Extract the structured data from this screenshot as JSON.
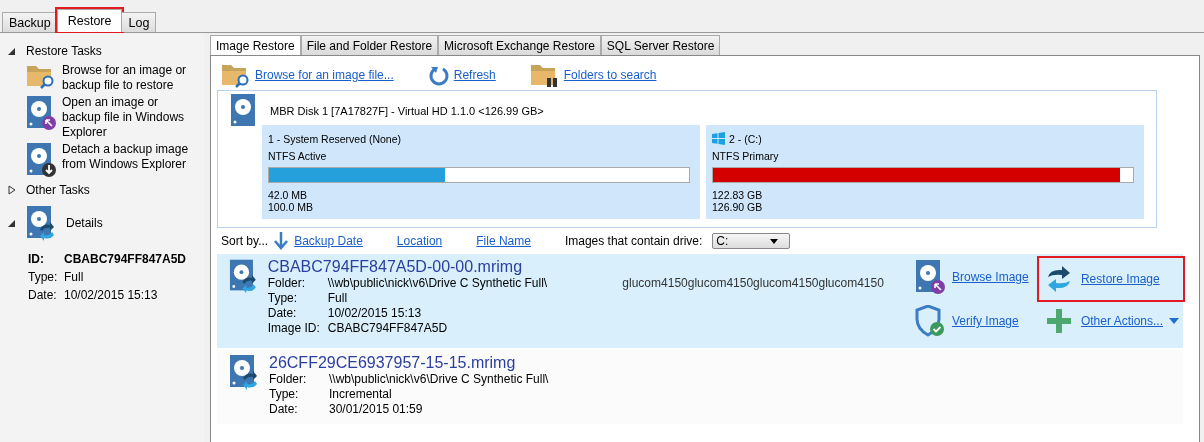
{
  "app_tabs": [
    {
      "label": "Backup",
      "selected": false,
      "highlighted": false
    },
    {
      "label": "Restore",
      "selected": true,
      "highlighted": true
    },
    {
      "label": "Log",
      "selected": false,
      "highlighted": false
    }
  ],
  "sidebar": {
    "sections": [
      {
        "title": "Restore Tasks",
        "expanded": true,
        "kind": "tasks",
        "items": [
          {
            "kind": "browse",
            "text": "Browse for an image or backup file to restore"
          },
          {
            "kind": "open",
            "text": "Open an image or backup file in Windows Explorer"
          },
          {
            "kind": "detach",
            "text": "Detach a backup image from Windows Explorer"
          }
        ]
      },
      {
        "title": "Other Tasks",
        "expanded": false,
        "kind": "tasks"
      },
      {
        "title": "Details",
        "expanded": true,
        "kind": "details",
        "fields": [
          {
            "label": "ID:",
            "value": "CBABC794FF847A5D",
            "bold": true
          },
          {
            "label": "Type:",
            "value": "Full",
            "bold": false
          },
          {
            "label": "Date:",
            "value": "10/02/2015 15:13",
            "bold": false
          }
        ]
      }
    ]
  },
  "tabs": [
    {
      "label": "Image Restore",
      "selected": true
    },
    {
      "label": "File and Folder Restore",
      "selected": false
    },
    {
      "label": "Microsoft Exchange Restore",
      "selected": false
    },
    {
      "label": "SQL Server Restore",
      "selected": false
    }
  ],
  "toolbar": [
    {
      "kind": "browse",
      "label": "Browse for an image file..."
    },
    {
      "kind": "refresh",
      "label": "Refresh"
    },
    {
      "kind": "folders",
      "label": "Folders to search"
    }
  ],
  "disk": {
    "title": "MBR Disk 1 [7A17827F] - Virtual HD 1.1.0  <126.99 GB>",
    "partitions": [
      {
        "name": "1 - System Reserved (None)",
        "windows_logo": false,
        "filesystem": "NTFS Active",
        "level": 0.42,
        "color": "#26a0da",
        "used": "42.0 MB",
        "total": "100.0 MB"
      },
      {
        "name": "2 -  (C:)",
        "windows_logo": true,
        "filesystem": "NTFS Primary",
        "level": 0.968,
        "color": "#d40000",
        "used": "122.83 GB",
        "total": "126.90 GB"
      }
    ]
  },
  "sort": {
    "label": "Sort by...",
    "options": [
      {
        "label": "Backup Date"
      },
      {
        "label": "Location"
      },
      {
        "label": "File Name"
      }
    ],
    "drive_label": "Images that contain drive:",
    "drive_value": "C:"
  },
  "images": [
    {
      "file": "CBABC794FF847A5D-00-00.mrimg",
      "selected": true,
      "fields": [
        {
          "label": "Folder:",
          "value": "\\\\wb\\public\\nick\\v6\\Drive C Synthetic Full\\"
        },
        {
          "label": "Type:",
          "value": "Full"
        },
        {
          "label": "Date:",
          "value": "10/02/2015 15:13"
        },
        {
          "label": "Image ID:",
          "value": "CBABC794FF847A5D"
        }
      ],
      "description": "glucom4150glucom4150glucom4150glucom4150",
      "actions": [
        {
          "kind": "browse",
          "label": "Browse Image",
          "highlighted": false
        },
        {
          "kind": "restore",
          "label": "Restore Image",
          "highlighted": true
        },
        {
          "kind": "verify",
          "label": "Verify Image",
          "highlighted": false
        },
        {
          "kind": "other",
          "label": "Other Actions...",
          "highlighted": false
        }
      ]
    },
    {
      "file": "26CFF29CE6937957-15-15.mrimg",
      "selected": false,
      "fields": [
        {
          "label": "Folder:",
          "value": "\\\\wb\\public\\nick\\v6\\Drive C Synthetic Full\\"
        },
        {
          "label": "Type:",
          "value": "Incremental"
        },
        {
          "label": "Date:",
          "value": "30/01/2015 01:59"
        }
      ]
    }
  ]
}
